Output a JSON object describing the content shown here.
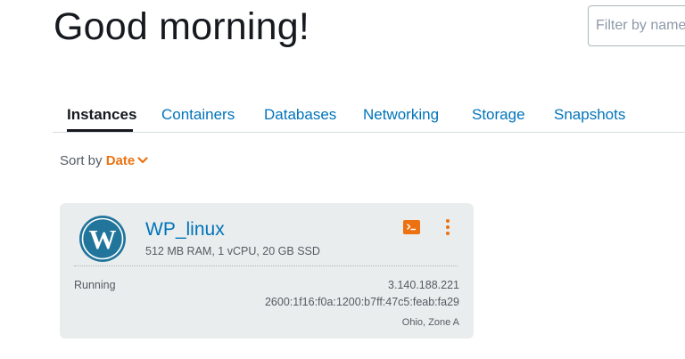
{
  "header": {
    "greeting": "Good morning!",
    "filter_placeholder": "Filter by name"
  },
  "tabs": [
    {
      "label": "Instances",
      "active": true
    },
    {
      "label": "Containers",
      "active": false
    },
    {
      "label": "Databases",
      "active": false
    },
    {
      "label": "Networking",
      "active": false
    },
    {
      "label": "Storage",
      "active": false
    },
    {
      "label": "Snapshots",
      "active": false
    }
  ],
  "sort": {
    "label": "Sort by",
    "value": "Date"
  },
  "instance": {
    "name": "WP_linux",
    "specs": "512 MB RAM, 1 vCPU, 20 GB SSD",
    "status": "Running",
    "ipv4": "3.140.188.221",
    "ipv6": "2600:1f16:f0a:1200:b7ff:47c5:feab:fa29",
    "zone": "Ohio, Zone A",
    "icon": "wordpress-icon"
  },
  "colors": {
    "link": "#0073bb",
    "accent": "#ec7211",
    "card_bg": "#eaeded",
    "text": "#16191f"
  }
}
